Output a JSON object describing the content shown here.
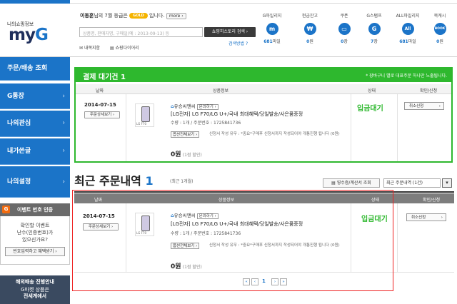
{
  "header": {
    "logo_sub": "나의쇼핑정보",
    "logo_main_prefix": "my",
    "logo_main_g": "G",
    "greeting_name": "이동훈",
    "greeting_mid": "님의 7월 등급은",
    "greeting_grade": "GOLD",
    "greeting_end": "입니다.",
    "more_label": "more",
    "search_placeholder": "상품명, 판매자명, 구매일(예 : 2013-09-13) 등",
    "search_button": "쇼핑히스토리 검색",
    "detail_search": "검색방법",
    "subnav": [
      "내쪽지함",
      "쇼핑다이어리"
    ],
    "stats": [
      {
        "label": "G마일리지",
        "icon": "m",
        "value": "681",
        "unit": "마일"
      },
      {
        "label": "현금잔고",
        "icon": "₩",
        "value": "0",
        "unit": "원"
      },
      {
        "label": "쿠폰",
        "icon": "▭",
        "value": "0",
        "unit": "장"
      },
      {
        "label": "G스탬프",
        "icon": "G",
        "value": "7",
        "unit": "장"
      },
      {
        "label": "ALL마일리지",
        "icon": "All",
        "value": "681",
        "unit": "마일"
      },
      {
        "label": "북캐시",
        "icon": "BOOK",
        "value": "0",
        "unit": "원"
      }
    ]
  },
  "sidebar": {
    "items": [
      {
        "label": "주문/배송 조회"
      },
      {
        "label": "G통장"
      },
      {
        "label": "나의관심"
      },
      {
        "label": "내가쓴글"
      },
      {
        "label": "나의설정"
      }
    ],
    "event": {
      "title": "이벤트 번호 인증",
      "text1": "확인할 이벤트",
      "text2": "난수(인증번호)가",
      "text3": "있으신가요?",
      "button": "번호입력하고 혜택받기"
    },
    "overseas": {
      "title": "해외배송 진행안내",
      "text1": "G마켓 상품은",
      "text2": "전세계에서"
    }
  },
  "pending": {
    "title": "결제 대기건",
    "count": "1",
    "notice": "* 장바구니 별로 대표주문 하나만 노출됩니다.",
    "columns": [
      "날짜",
      "상품정보",
      "상태",
      "확인/신청"
    ]
  },
  "orders": {
    "title": "최근 주문내역",
    "count": "1",
    "subtitle": "(최근 1개월)",
    "receipt_button": "영수증/계산서 조회",
    "period_select": "최근 주문내역 (1건)",
    "columns": [
      "날짜",
      "상품정보",
      "상태",
      "확인/신청"
    ]
  },
  "order_item": {
    "date": "2014-07-15",
    "detail_button": "주문상세보기",
    "seller": "유승씨앤씨",
    "inquiry_button": "문의하기",
    "product": "[LG전자] LG F70/LG U+/국내 최대혜택/당일발송/사은품증정",
    "meta": "수량 : 1개 / 주문번호 : 1725841736",
    "option_button": "옵션전체보기",
    "option_note": "신청서 작성 유무 : *중요*구매후 신청서까지 작성되어야 개통진행 됩니다 (0원)",
    "price_value": "0",
    "price_unit": "원",
    "price_note": "(1점 할인)",
    "thumb_caption": "LG F70",
    "status": "입금대기",
    "cancel_button": "취소신청"
  },
  "pager": {
    "first": "«",
    "prev": "‹",
    "current": "1",
    "next": "›",
    "last": "»"
  },
  "colors": {
    "brand_blue": "#1b74c8",
    "pending_green": "#2eb82e",
    "highlight_red": "#ee2222"
  }
}
